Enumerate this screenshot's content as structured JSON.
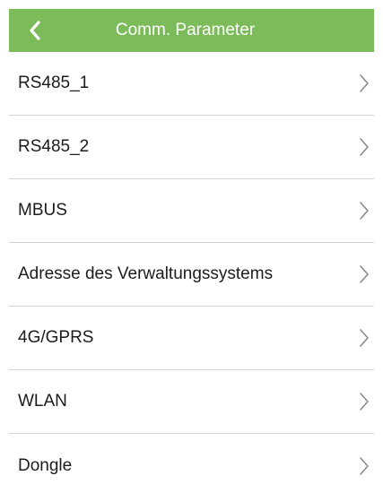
{
  "header": {
    "title": "Comm. Parameter",
    "back_icon": "back-chevron-icon",
    "color": "#7cbb5a"
  },
  "list": {
    "items": [
      {
        "label": "RS485_1"
      },
      {
        "label": "RS485_2"
      },
      {
        "label": "MBUS"
      },
      {
        "label": "Adresse des Verwaltungssystems"
      },
      {
        "label": "4G/GPRS"
      },
      {
        "label": "WLAN"
      },
      {
        "label": "Dongle"
      }
    ],
    "item_icon": "chevron-right-icon"
  }
}
